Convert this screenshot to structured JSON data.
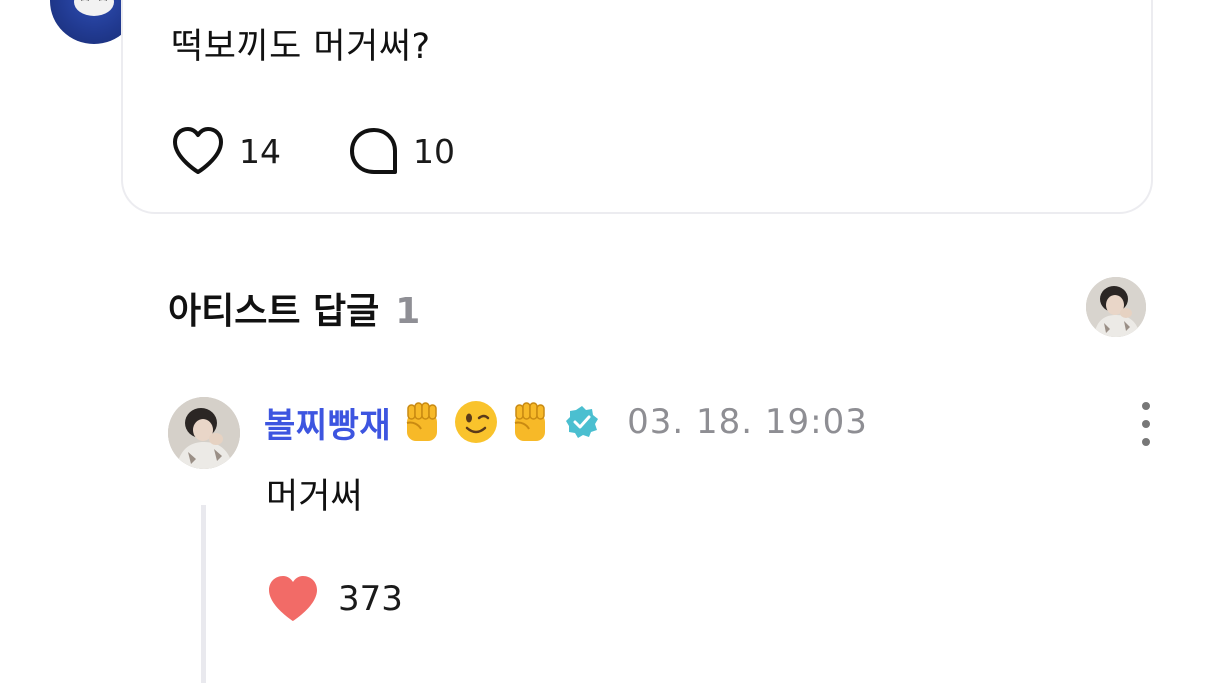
{
  "post": {
    "text": "떡보끼도 머거써?",
    "like_count": "14",
    "comment_count": "10",
    "author_avatar_icon": "panda-avatar-icon"
  },
  "artist_replies": {
    "title": "아티스트 답글",
    "count": "1",
    "header_avatar_icon": "artist-avatar-icon"
  },
  "reply": {
    "author_name": "볼찌빵재",
    "name_emojis": [
      "✊",
      "😉",
      "✊"
    ],
    "verified_icon": "verified-badge-icon",
    "timestamp": "03. 18. 19:03",
    "text": "머거써",
    "like_count": "373",
    "like_color": "#f26b67"
  },
  "colors": {
    "name_accent": "#3d55e0",
    "verified": "#4bbfd0",
    "muted": "#8e8e93"
  }
}
